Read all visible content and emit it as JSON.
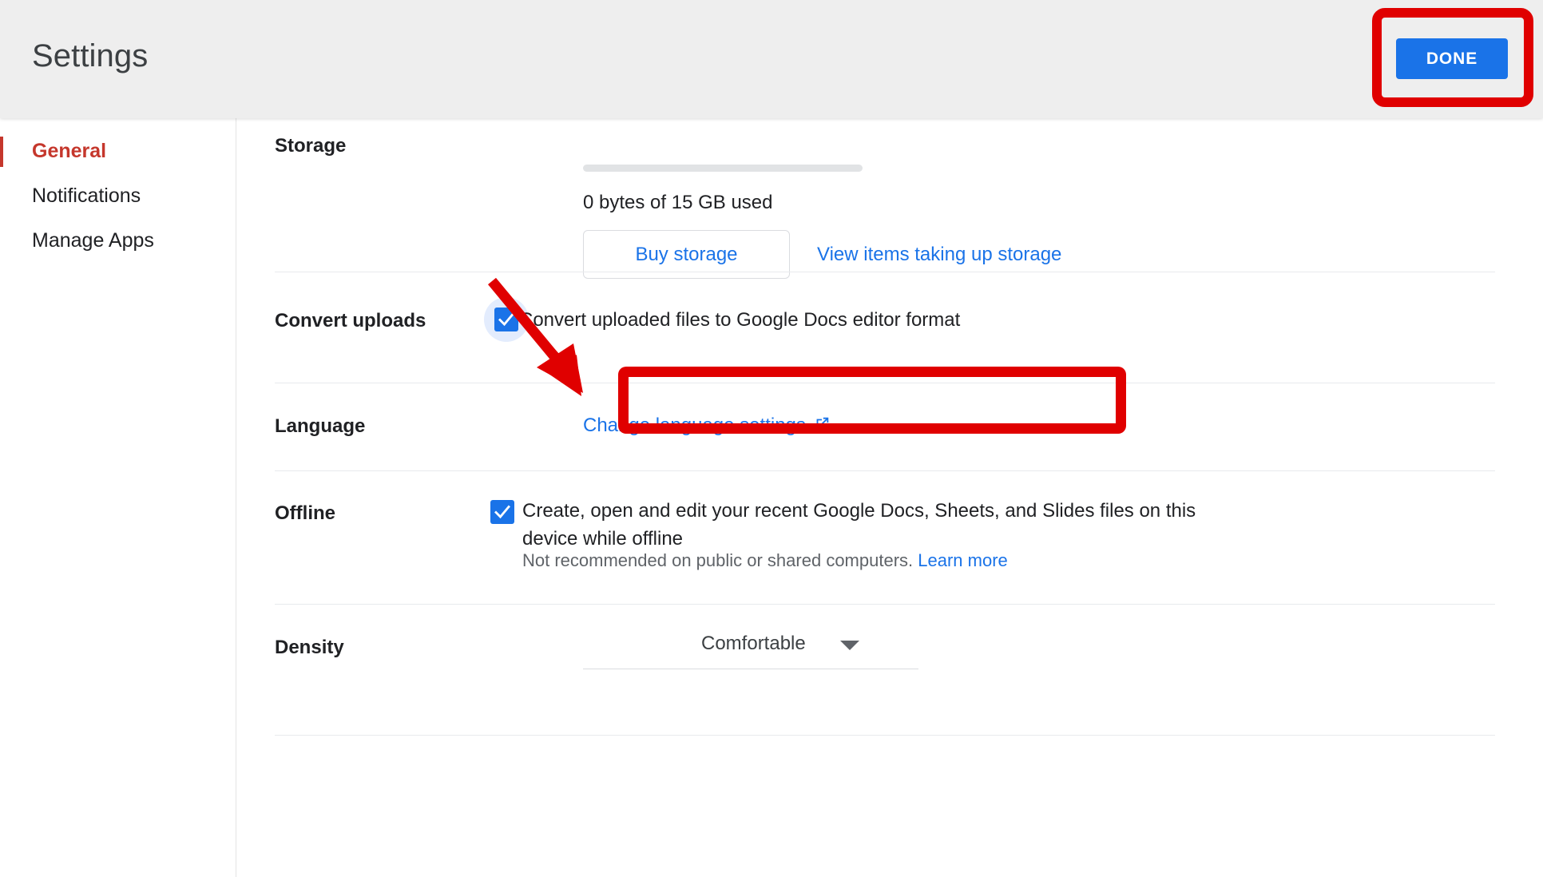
{
  "header": {
    "title": "Settings",
    "done_label": "DONE"
  },
  "sidebar": {
    "items": [
      {
        "label": "General",
        "active": true
      },
      {
        "label": "Notifications",
        "active": false
      },
      {
        "label": "Manage Apps",
        "active": false
      }
    ]
  },
  "sections": {
    "storage": {
      "label": "Storage",
      "usage_text": "0 bytes of 15 GB used",
      "buy_label": "Buy storage",
      "view_items_label": "View items taking up storage",
      "used_percent": 0
    },
    "convert_uploads": {
      "label": "Convert uploads",
      "checkbox_label": "Convert uploaded files to Google Docs editor format",
      "checked": true
    },
    "language": {
      "label": "Language",
      "link_label": "Change language settings",
      "link_icon": "external-link-icon"
    },
    "offline": {
      "label": "Offline",
      "checkbox_label": "Create, open and edit your recent Google Docs, Sheets, and Slides files on this device while offline",
      "checked": true,
      "note": "Not recommended on public or shared computers.",
      "learn_more_label": "Learn more"
    },
    "density": {
      "label": "Density",
      "value": "Comfortable",
      "caret_icon": "chevron-down-icon"
    }
  },
  "annotations": {
    "done_highlight_color": "#e00000",
    "convert_highlight_color": "#e00000",
    "arrow_color": "#e00000"
  },
  "colors": {
    "accent_blue": "#1a73e8",
    "active_nav": "#c5372c",
    "header_bg": "#eeeeee",
    "divider": "#e8eaed"
  }
}
